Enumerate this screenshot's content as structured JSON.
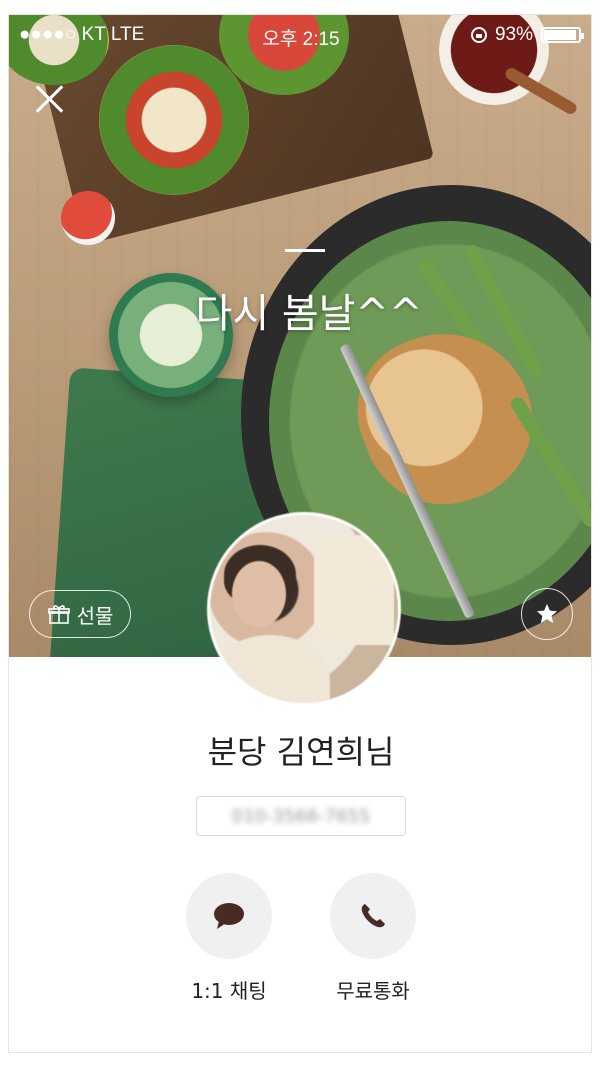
{
  "status_bar": {
    "carrier": "●●●●○ KT  LTE",
    "time": "오후 2:15",
    "battery_text": "93%",
    "battery_level": 0.93
  },
  "profile": {
    "status_message": "다시 봄날^^",
    "name": "분당 김연희님",
    "phone": "010-3566-7655"
  },
  "buttons": {
    "gift_label": "선물",
    "chat_label": "1:1 채팅",
    "call_label": "무료통화"
  },
  "icons": {
    "close": "close-icon",
    "gift": "gift-icon",
    "favorite": "star-icon",
    "chat": "speech-bubble-icon",
    "call": "phone-icon",
    "lock": "rotation-lock-icon",
    "battery": "battery-icon"
  },
  "colors": {
    "icon_dark": "#4a2a24",
    "action_circle": "#f0f0f0"
  }
}
